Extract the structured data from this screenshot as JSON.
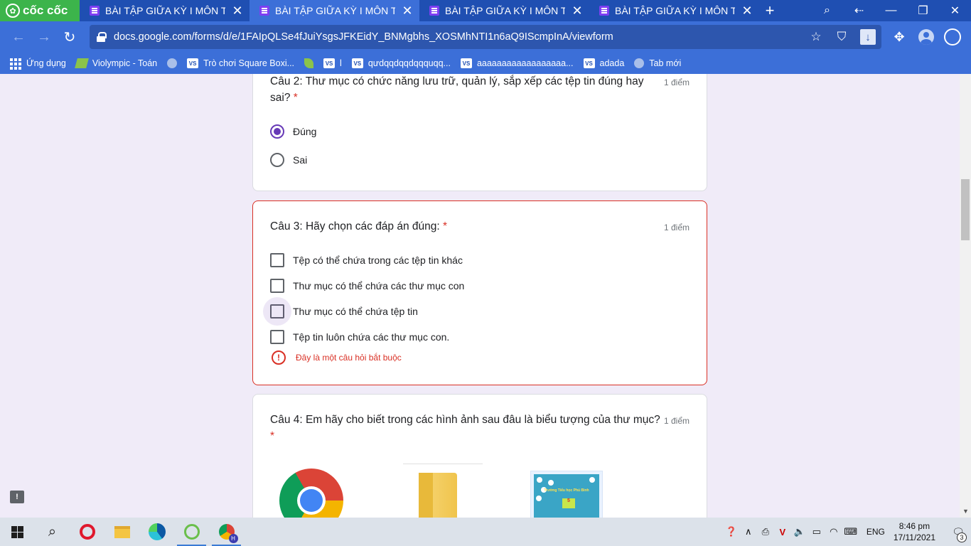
{
  "browser": {
    "brand": "cốc cốc",
    "tabs": [
      {
        "title": "BÀI TẬP GIỮA KỲ I MÔN TIN",
        "active": false
      },
      {
        "title": "BÀI TẬP GIỮA KỲ I MÔN TIN",
        "active": true
      },
      {
        "title": "BÀI TẬP GIỮA KỲ I MÔN TIN",
        "active": false
      },
      {
        "title": "BÀI TẬP GIỮA KỲ I MÔN TIN",
        "active": false
      }
    ],
    "url": "docs.google.com/forms/d/e/1FAIpQLSe4fJuiYsgsJFKEidY_BNMgbhs_XOSMhNTI1n6aQ9IScmpInA/viewform",
    "bookmarks": [
      {
        "label": "Ứng dụng",
        "icon": "apps-icon"
      },
      {
        "label": "Violympic - Toán",
        "icon": "violympic-icon"
      },
      {
        "label": "",
        "icon": "globe-icon"
      },
      {
        "label": "Trò chơi Square Boxi...",
        "icon": "vs-icon"
      },
      {
        "label": "",
        "icon": "leaf-icon"
      },
      {
        "label": "l",
        "icon": "vs-icon"
      },
      {
        "label": "qưdqqdqqdqqquqq...",
        "icon": "vs-icon"
      },
      {
        "label": "aaaaaaaaaaaaaaaaaa...",
        "icon": "vs-icon"
      },
      {
        "label": "adada",
        "icon": "vs-icon"
      },
      {
        "label": "Tab mới",
        "icon": "globe-icon"
      }
    ],
    "vs_badge": "VS"
  },
  "form": {
    "required_mark": "*",
    "q2": {
      "title": "Câu 2: Thư mục có chức năng lưu trữ, quản lý, sắp xếp các tệp tin đúng hay sai?",
      "points": "1 điểm",
      "options": [
        {
          "label": "Đúng",
          "checked": true
        },
        {
          "label": "Sai",
          "checked": false
        }
      ]
    },
    "q3": {
      "title": "Câu 3: Hãy chọn các đáp án đúng:",
      "points": "1 điểm",
      "options": [
        {
          "label": "Tệp có thể chứa trong các tệp tin khác",
          "checked": false
        },
        {
          "label": "Thư mục có thể chứa các thư mục con",
          "checked": false
        },
        {
          "label": "Thư mục có thể chứa tệp tin",
          "checked": false
        },
        {
          "label": "Tệp tin luôn chứa các thư mục con.",
          "checked": false
        }
      ],
      "error": "Đây là một câu hỏi bắt buộc"
    },
    "q4": {
      "title": "Câu 4: Em hãy cho biết trong các hình ảnh sau đâu là biểu tượng của thư mục?",
      "points": "1 điểm",
      "book_text": "Trường Tiểu học Phú Bình",
      "book_grade": "5"
    }
  },
  "taskbar": {
    "language": "ENG",
    "time": "8:46 pm",
    "date": "17/11/2021",
    "notifications": "3"
  }
}
